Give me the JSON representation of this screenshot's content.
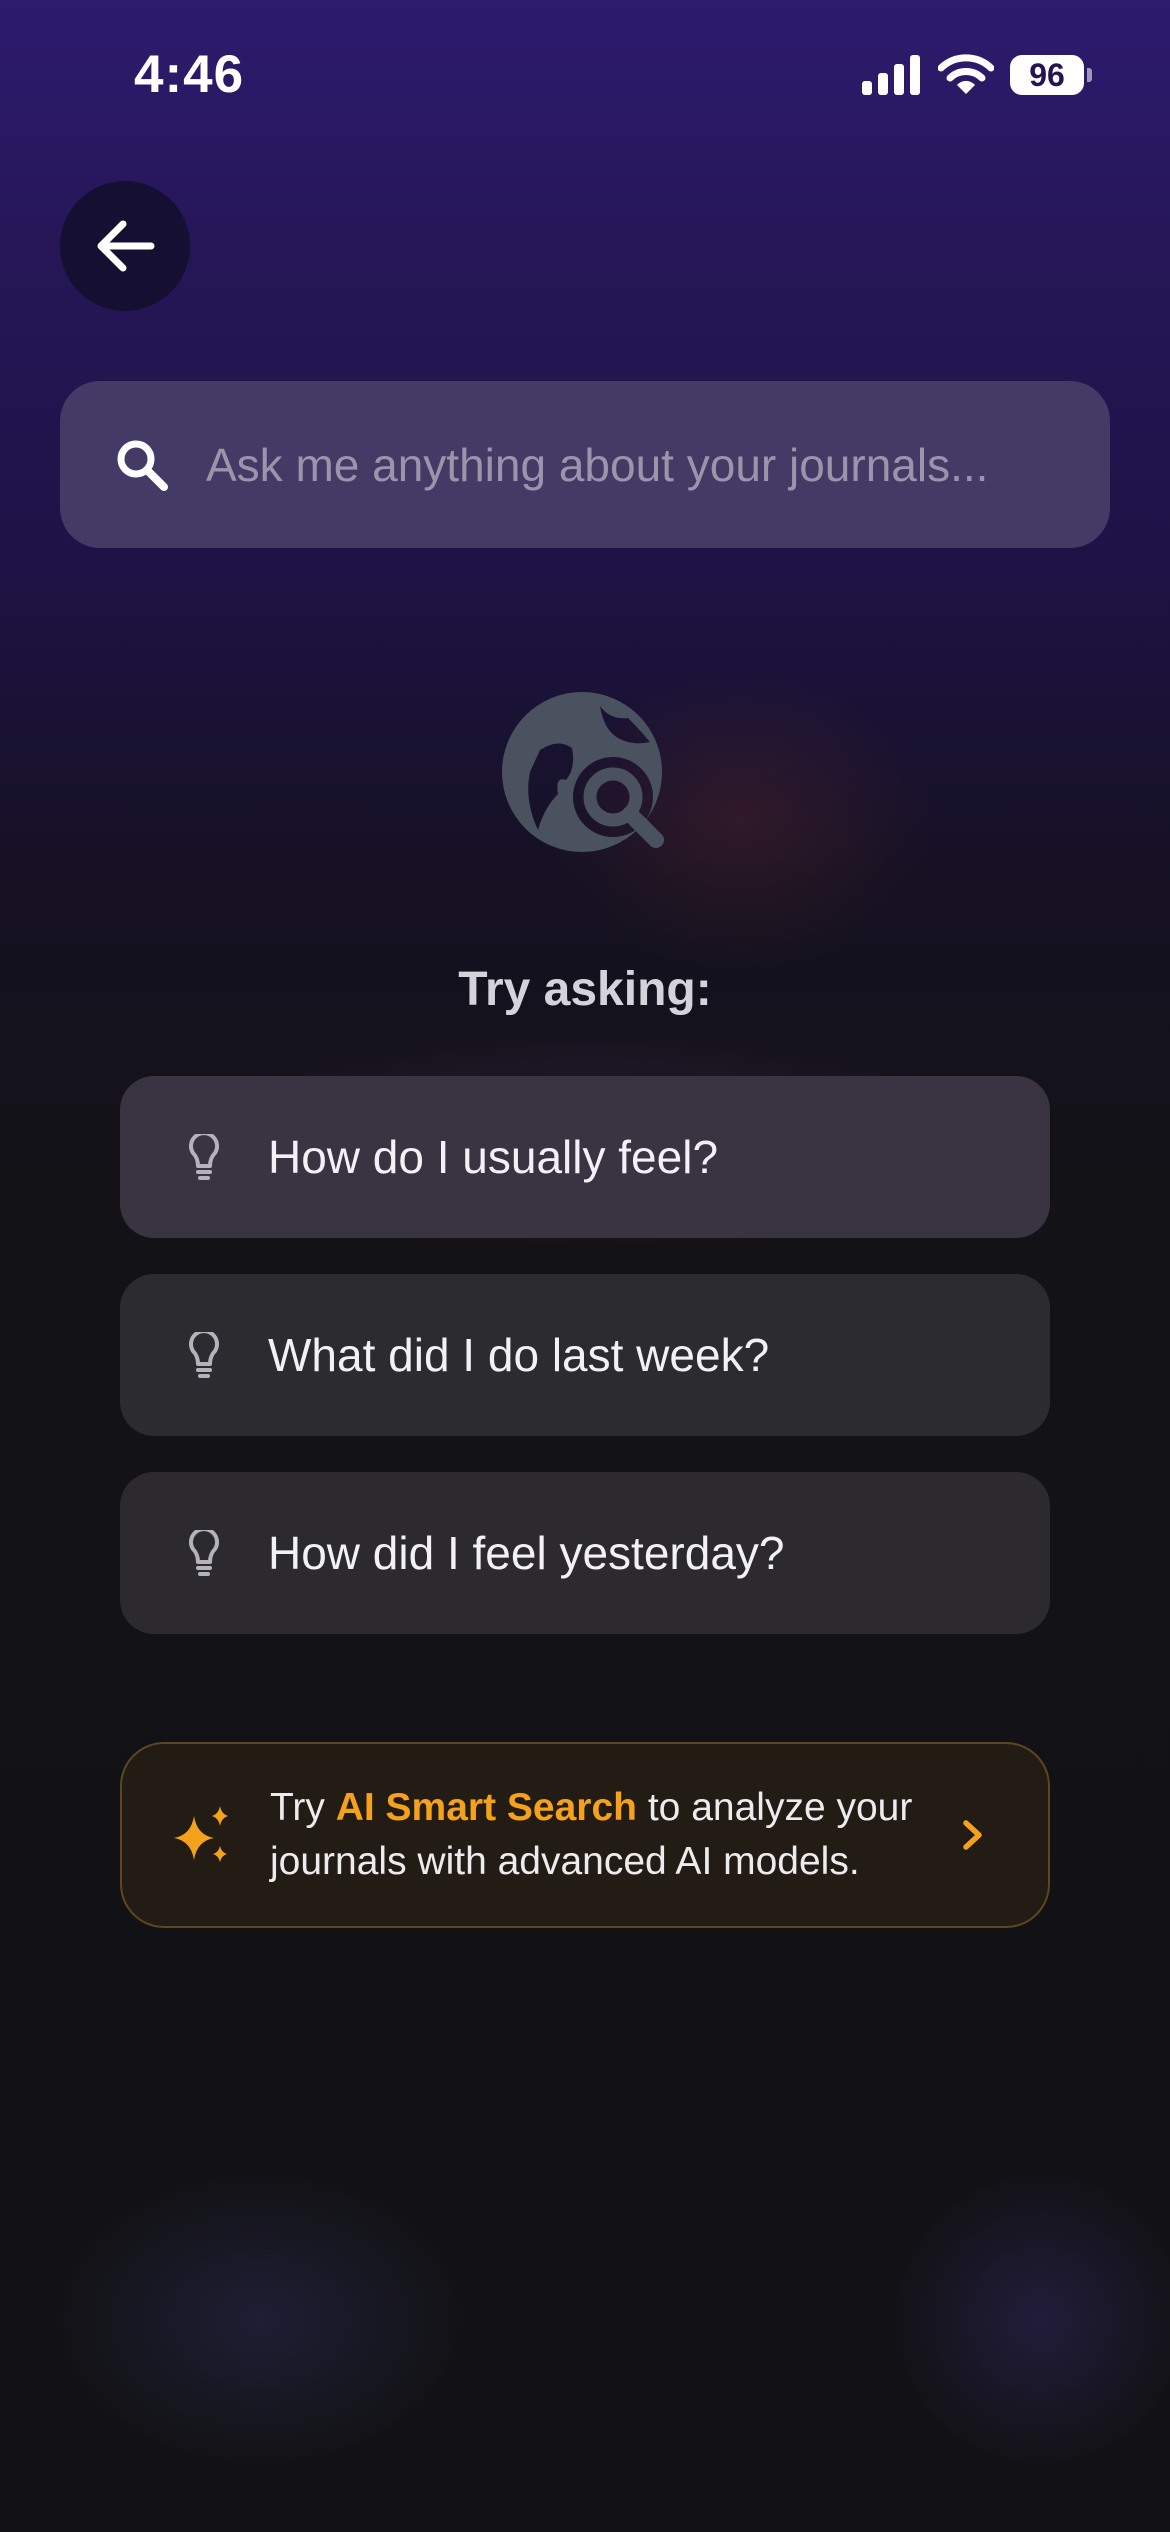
{
  "status_bar": {
    "time": "4:46",
    "battery": "96",
    "icons": [
      "signal-icon",
      "wifi-icon",
      "battery-icon"
    ]
  },
  "header": {
    "back_icon": "back-arrow-icon"
  },
  "search": {
    "placeholder": "Ask me anything about your journals...",
    "value": "",
    "icon": "search-icon"
  },
  "empty_state": {
    "icon": "globe-search-icon",
    "heading": "Try asking:"
  },
  "suggestions": [
    {
      "label": "How do I usually feel?",
      "icon": "lightbulb-icon"
    },
    {
      "label": "What did I do last week?",
      "icon": "lightbulb-icon"
    },
    {
      "label": "How did I feel yesterday?",
      "icon": "lightbulb-icon"
    }
  ],
  "promo": {
    "prefix": "Try ",
    "highlight": "AI Smart Search",
    "suffix": " to analyze your journals with advanced AI models.",
    "icon": "sparkles-icon",
    "chevron": "chevron-right-icon"
  },
  "colors": {
    "accent": "#f4a21c",
    "background_top": "#2d1b6e",
    "background_bottom": "#121215",
    "search_bar": "#433a66",
    "suggestion_card": "#2c2b30"
  }
}
